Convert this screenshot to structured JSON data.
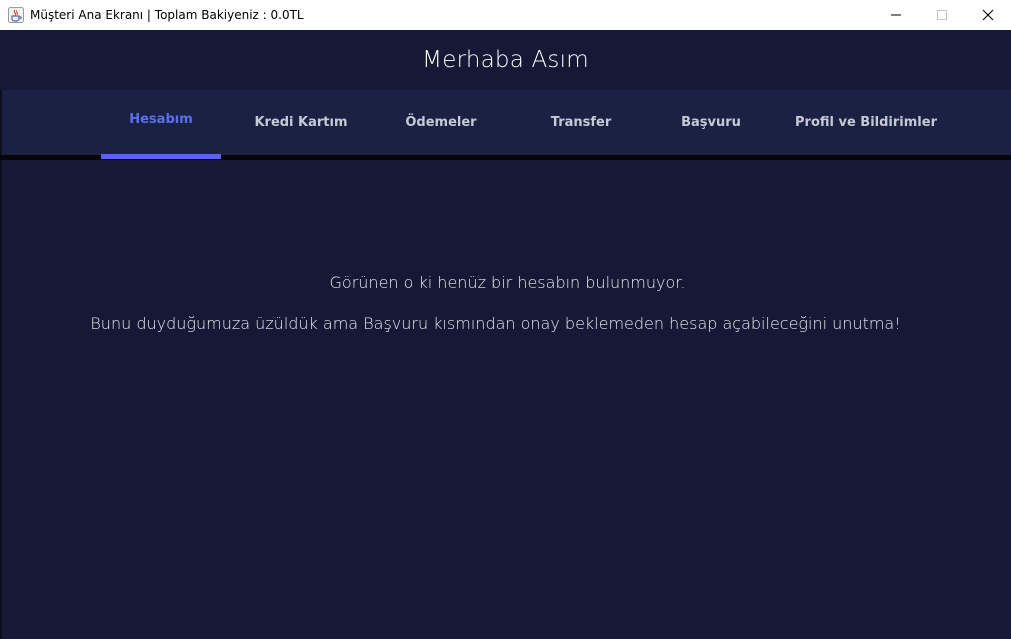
{
  "window": {
    "title": "Müşteri Ana Ekranı | Toplam Bakiyeniz : 0.0TL",
    "icon": "java-cup-icon",
    "controls": {
      "minimize": "minimize-icon",
      "maximize": "maximize-icon",
      "close": "close-icon"
    }
  },
  "header": {
    "greeting": "Merhaba Asım"
  },
  "tabs": [
    {
      "label": "Hesabım",
      "active": true
    },
    {
      "label": "Kredi Kartım",
      "active": false
    },
    {
      "label": "Ödemeler",
      "active": false
    },
    {
      "label": "Transfer",
      "active": false
    },
    {
      "label": "Başvuru",
      "active": false
    },
    {
      "label": "Profil ve Bildirimler",
      "active": false
    }
  ],
  "main": {
    "message_line1": "Görünen o ki henüz bir hesabın bulunmuyor.",
    "message_line2": "Bunu duyduğumuza üzüldük ama Başvuru kısmından onay beklemeden hesap açabileceğini unutma!"
  },
  "colors": {
    "background": "#161935",
    "tabbar": "#1b2142",
    "active_tab": "#5b6ef0",
    "tab_text": "#c7cad6",
    "text": "#e8e9f0"
  }
}
